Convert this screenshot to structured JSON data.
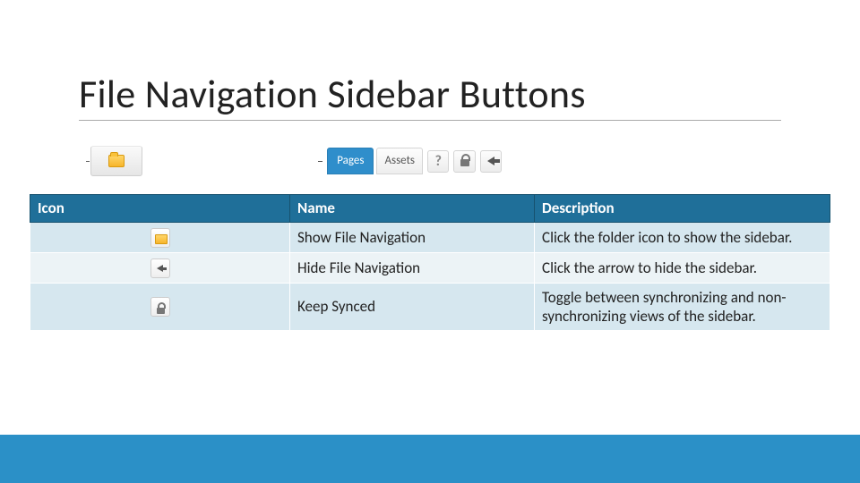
{
  "title": "File Navigation Sidebar Buttons",
  "toolbar": {
    "tab_active": "Pages",
    "tab_inactive": "Assets"
  },
  "table": {
    "headers": {
      "icon": "Icon",
      "name": "Name",
      "desc": "Description"
    },
    "rows": [
      {
        "name": "Show File Navigation",
        "desc": "Click the folder icon to show the sidebar."
      },
      {
        "name": "Hide File Navigation",
        "desc": "Click the arrow to hide the sidebar."
      },
      {
        "name": "Keep Synced",
        "desc": "Toggle between synchronizing and non-synchronizing views of the sidebar."
      }
    ]
  }
}
